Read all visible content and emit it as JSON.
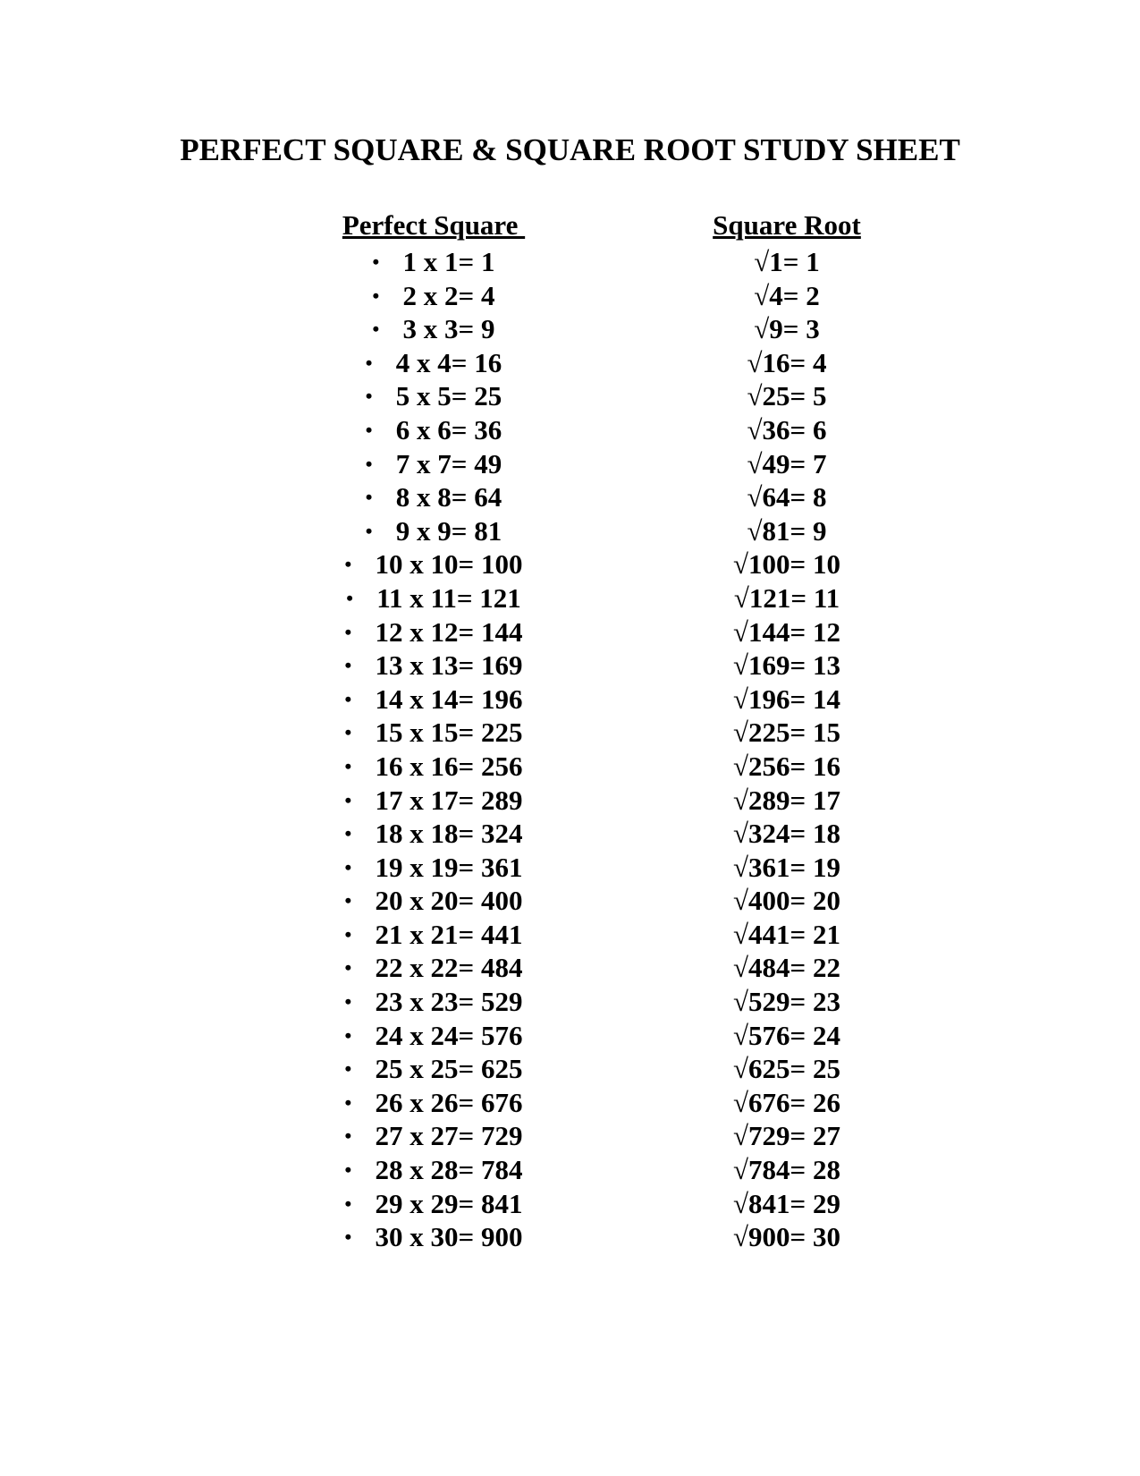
{
  "title": "PERFECT SQUARE & SQUARE ROOT STUDY SHEET",
  "columns": {
    "perfect_square_header": "Perfect Square ",
    "square_root_header": "Square Root"
  },
  "bullet_glyph": "•",
  "perfect_squares": [
    "1 x 1= 1",
    "2 x 2= 4",
    "3 x 3= 9",
    "4 x 4= 16",
    "5 x 5= 25",
    "6 x 6= 36",
    "7 x 7= 49",
    "8 x 8= 64",
    "9 x 9= 81",
    "10 x 10= 100",
    "11 x 11= 121",
    "12 x 12= 144",
    "13 x 13= 169",
    "14 x 14= 196",
    "15 x 15= 225",
    "16 x 16= 256",
    "17 x 17= 289",
    "18 x 18= 324",
    "19 x 19= 361",
    "20 x 20= 400",
    "21 x 21= 441",
    "22 x 22= 484",
    "23 x 23= 529",
    "24 x 24= 576",
    "25 x 25= 625",
    "26 x 26= 676",
    "27 x 27= 729",
    "28 x 28= 784",
    "29 x 29= 841",
    "30 x 30= 900"
  ],
  "square_roots": [
    "√1= 1",
    "√4= 2",
    "√9= 3",
    "√16= 4",
    "√25= 5",
    "√36= 6",
    "√49= 7",
    "√64= 8",
    "√81= 9",
    "√100= 10",
    "√121= 11",
    "√144= 12",
    "√169= 13",
    "√196= 14",
    "√225= 15",
    "√256= 16",
    "√289= 17",
    "√324= 18",
    "√361= 19",
    "√400= 20",
    "√441= 21",
    "√484= 22",
    "√529= 23",
    "√576= 24",
    "√625= 25",
    "√676= 26",
    "√729= 27",
    "√784= 28",
    "√841= 29",
    "√900= 30"
  ]
}
